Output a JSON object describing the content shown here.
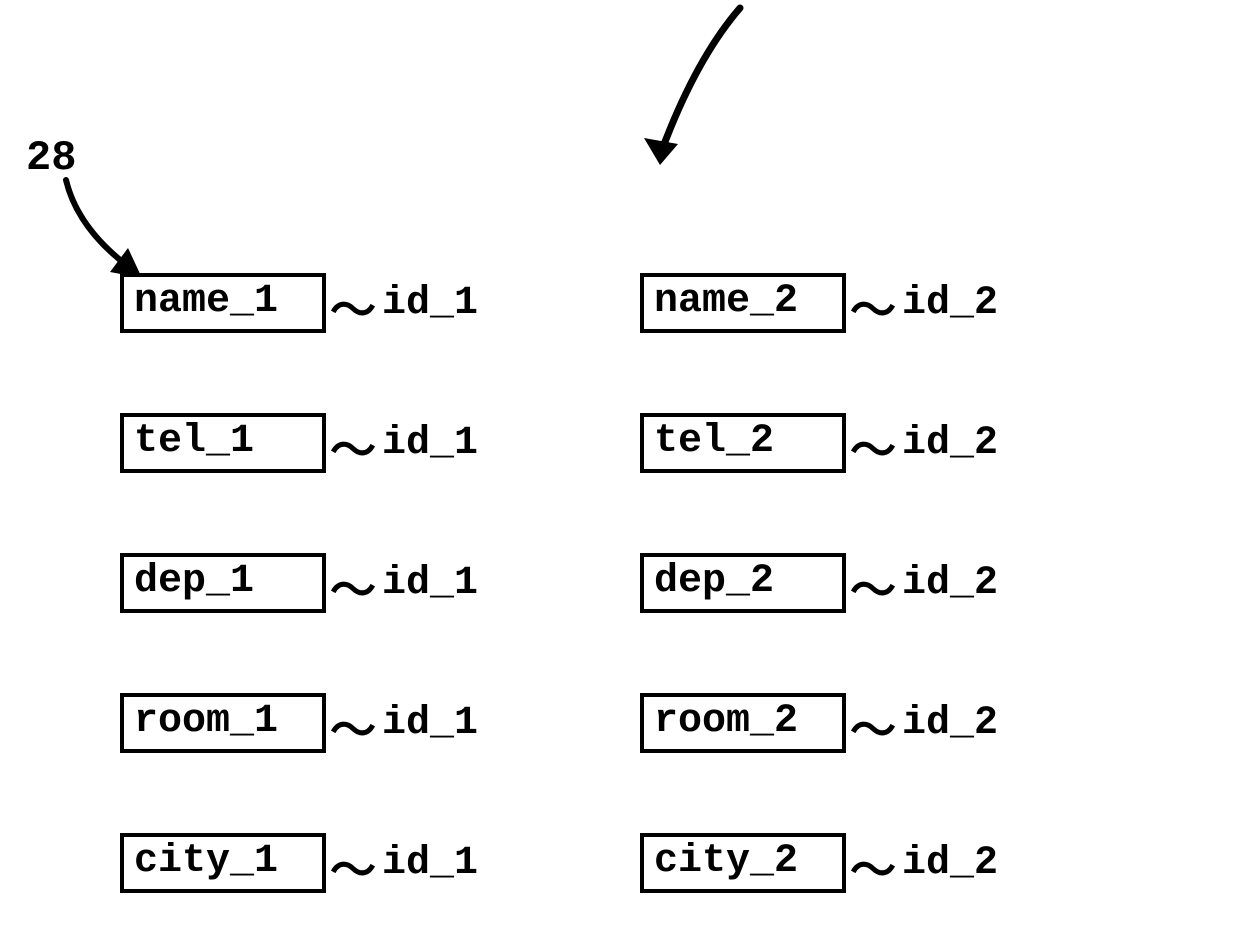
{
  "reference_number": "28",
  "columns": [
    {
      "id_label": "id_1",
      "fields": [
        "name_1",
        "tel_1",
        "dep_1",
        "room_1",
        "city_1"
      ]
    },
    {
      "id_label": "id_2",
      "fields": [
        "name_2",
        "tel_2",
        "dep_2",
        "room_2",
        "city_2"
      ]
    }
  ]
}
